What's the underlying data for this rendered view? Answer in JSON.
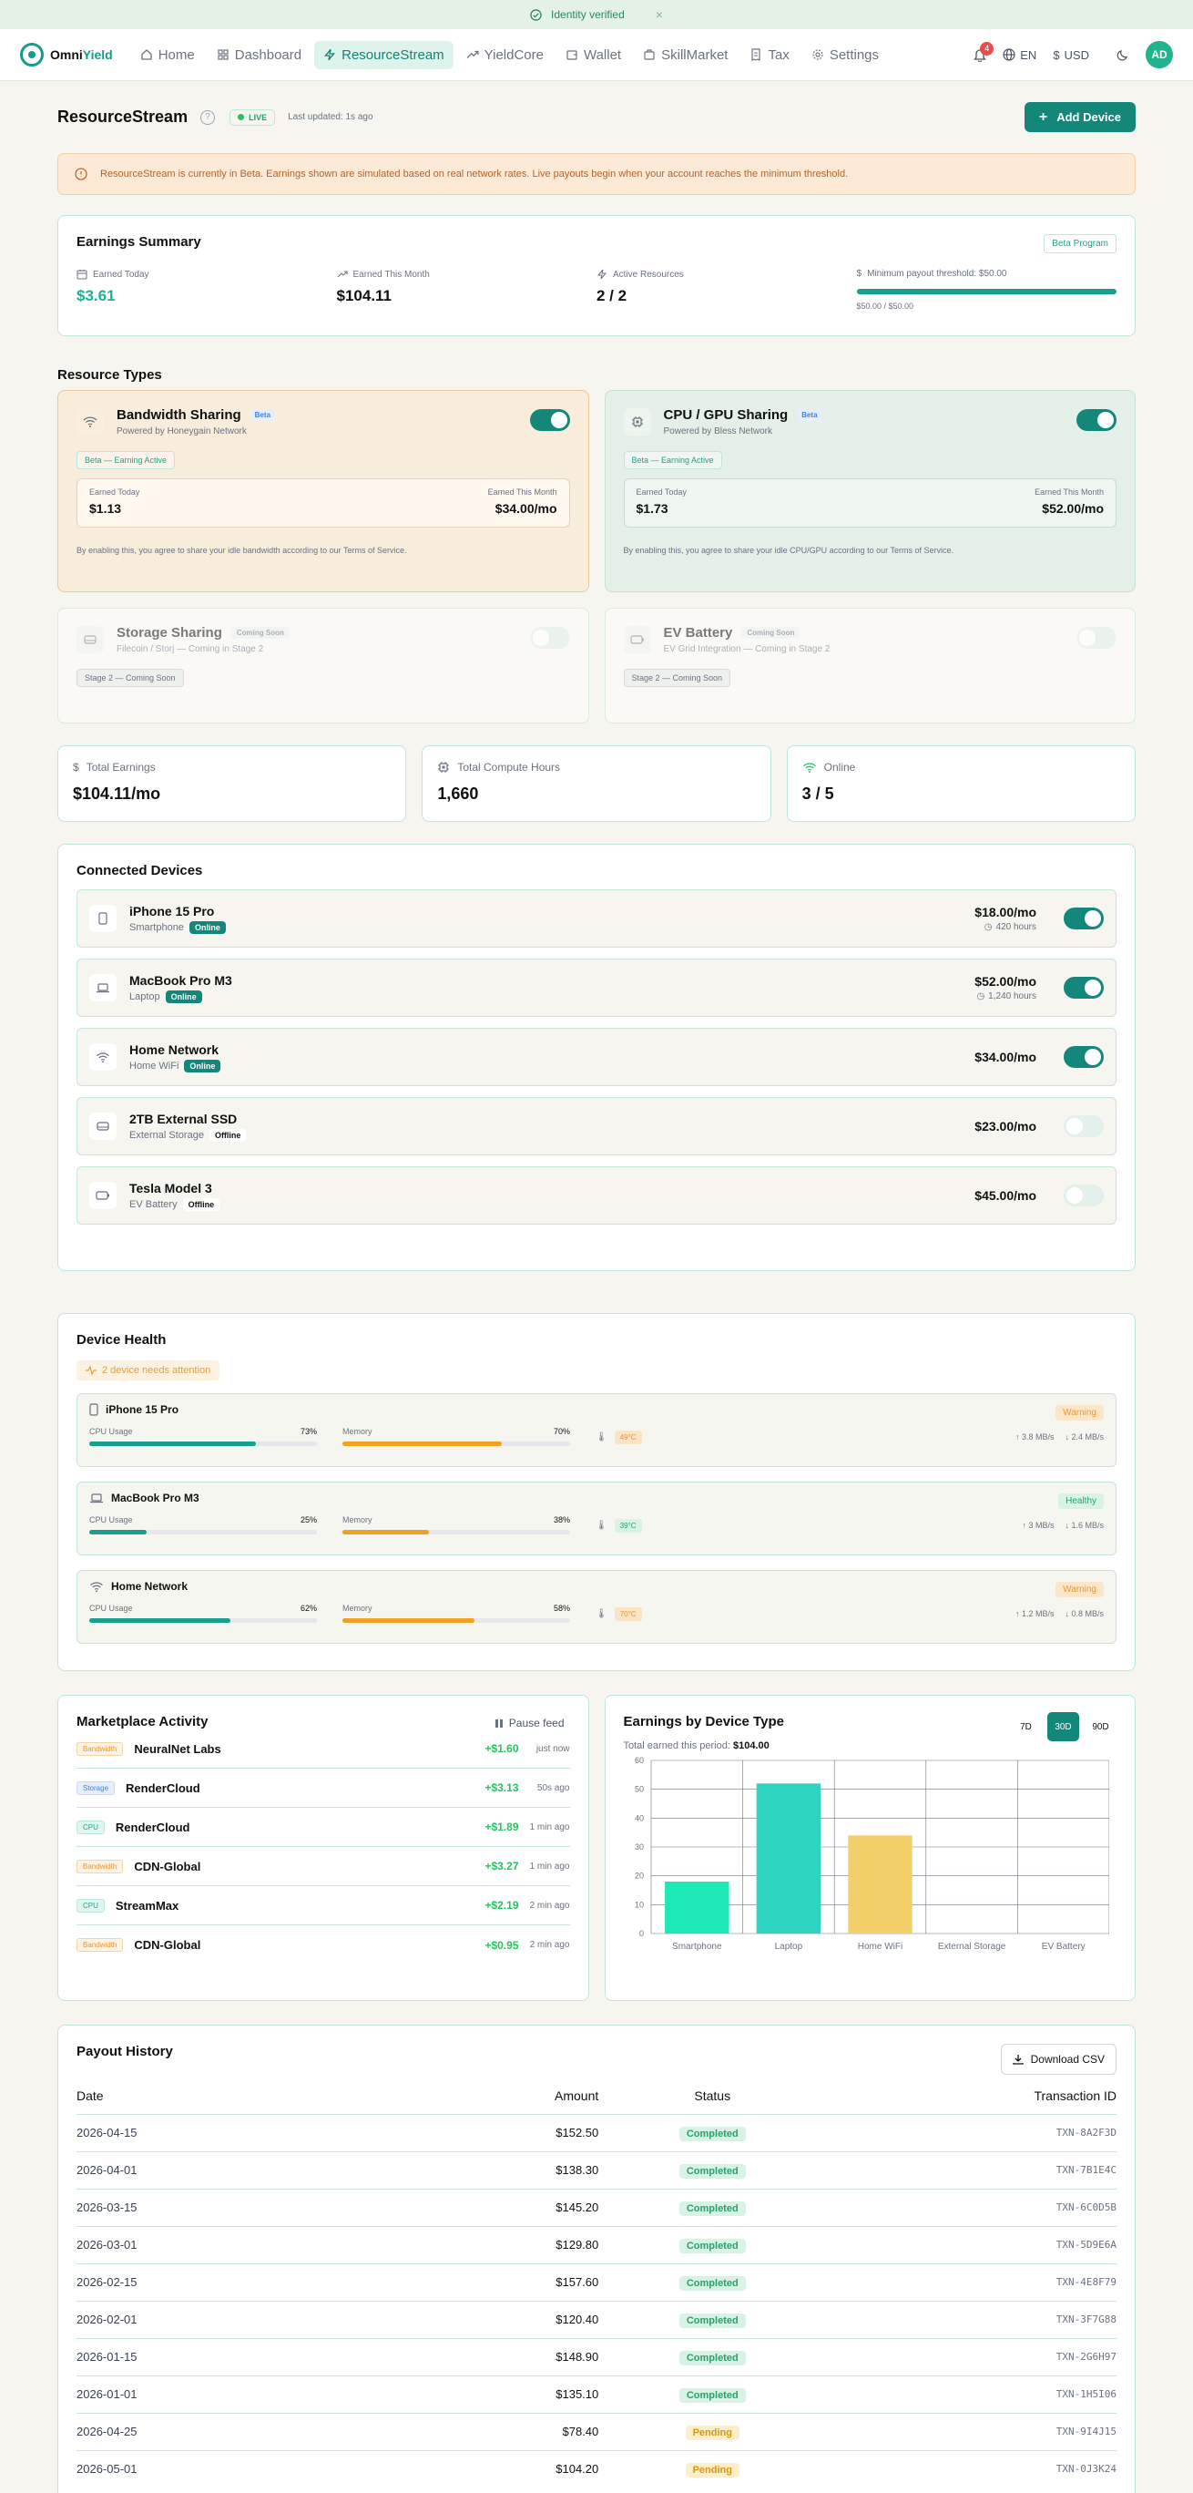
{
  "banner": {
    "text": "Identity verified",
    "close": "×"
  },
  "nav": {
    "brand_a": "Omni",
    "brand_b": "Yield",
    "items": [
      {
        "label": "Home",
        "icon": "home-icon"
      },
      {
        "label": "Dashboard",
        "icon": "grid-icon"
      },
      {
        "label": "ResourceStream",
        "icon": "bolt-icon",
        "active": true
      },
      {
        "label": "YieldCore",
        "icon": "trend-icon"
      },
      {
        "label": "Wallet",
        "icon": "wallet-icon"
      },
      {
        "label": "SkillMarket",
        "icon": "briefcase-icon"
      },
      {
        "label": "Tax",
        "icon": "receipt-icon"
      },
      {
        "label": "Settings",
        "icon": "gear-icon"
      }
    ],
    "notif_count": "4",
    "lang": "EN",
    "currency": "USD",
    "avatar": "AD"
  },
  "page": {
    "title": "ResourceStream",
    "live": "LIVE",
    "updated": "Last updated: 1s ago",
    "add_device": "Add Device"
  },
  "alert": "ResourceStream is currently in Beta. Earnings shown are simulated based on real network rates. Live payouts begin when your account reaches the minimum threshold.",
  "earnings": {
    "title": "Earnings Summary",
    "badge": "Beta Program",
    "today_label": "Earned Today",
    "today": "$3.61",
    "month_label": "Earned This Month",
    "month": "$104.11",
    "active_label": "Active Resources",
    "active": "2 / 2",
    "threshold_label": "Minimum payout threshold: $50.00",
    "threshold_progress": 1.0,
    "threshold_value": "$50.00 / $50.00"
  },
  "resources": {
    "title": "Resource Types",
    "bandwidth": {
      "name": "Bandwidth Sharing",
      "tag": "Beta",
      "sub": "Powered by Honeygain Network",
      "status": "Beta — Earning Active",
      "today_label": "Earned Today",
      "today": "$1.13",
      "month_label": "Earned This Month",
      "month": "$34.00/mo",
      "terms": "By enabling this, you agree to share your idle bandwidth according to our Terms of Service."
    },
    "cpu": {
      "name": "CPU / GPU Sharing",
      "tag": "Beta",
      "sub": "Powered by Bless Network",
      "status": "Beta — Earning Active",
      "today_label": "Earned Today",
      "today": "$1.73",
      "month_label": "Earned This Month",
      "month": "$52.00/mo",
      "terms": "By enabling this, you agree to share your idle CPU/GPU according to our Terms of Service."
    },
    "storage": {
      "name": "Storage Sharing",
      "tag": "Coming Soon",
      "sub": "Filecoin / Storj — Coming in Stage 2",
      "status": "Stage 2 — Coming Soon"
    },
    "ev": {
      "name": "EV Battery",
      "tag": "Coming Soon",
      "sub": "EV Grid Integration — Coming in Stage 2",
      "status": "Stage 2 — Coming Soon"
    }
  },
  "totals": {
    "earnings_label": "Total Earnings",
    "earnings": "$104.11/mo",
    "compute_label": "Total Compute Hours",
    "compute": "1,660",
    "online_label": "Online",
    "online": "3 / 5"
  },
  "devices": {
    "title": "Connected Devices",
    "items": [
      {
        "name": "iPhone 15 Pro",
        "type": "Smartphone",
        "status": "Online",
        "price": "$18.00/mo",
        "hours": "420 hours",
        "on": true,
        "icon": "phone-icon"
      },
      {
        "name": "MacBook Pro M3",
        "type": "Laptop",
        "status": "Online",
        "price": "$52.00/mo",
        "hours": "1,240 hours",
        "on": true,
        "icon": "laptop-icon"
      },
      {
        "name": "Home Network",
        "type": "Home WiFi",
        "status": "Online",
        "price": "$34.00/mo",
        "hours": "",
        "on": true,
        "icon": "wifi-icon"
      },
      {
        "name": "2TB External SSD",
        "type": "External Storage",
        "status": "Offline",
        "price": "$23.00/mo",
        "hours": "",
        "on": false,
        "icon": "drive-icon"
      },
      {
        "name": "Tesla Model 3",
        "type": "EV Battery",
        "status": "Offline",
        "price": "$45.00/mo",
        "hours": "",
        "on": false,
        "icon": "battery-icon"
      }
    ]
  },
  "health": {
    "title": "Device Health",
    "attention": "2 device needs attention",
    "cpu_label": "CPU Usage",
    "mem_label": "Memory",
    "items": [
      {
        "name": "iPhone 15 Pro",
        "status": "Warning",
        "cpu": "73%",
        "cpu_v": 0.73,
        "mem": "70%",
        "mem_v": 0.7,
        "temp": "49°C",
        "up": "3.8 MB/s",
        "down": "2.4 MB/s",
        "icon": "phone-icon"
      },
      {
        "name": "MacBook Pro M3",
        "status": "Healthy",
        "cpu": "25%",
        "cpu_v": 0.25,
        "mem": "38%",
        "mem_v": 0.38,
        "temp": "39°C",
        "up": "3 MB/s",
        "down": "1.6 MB/s",
        "icon": "laptop-icon"
      },
      {
        "name": "Home Network",
        "status": "Warning",
        "cpu": "62%",
        "cpu_v": 0.62,
        "mem": "58%",
        "mem_v": 0.58,
        "temp": "70°C",
        "up": "1.2 MB/s",
        "down": "0.8 MB/s",
        "icon": "wifi-icon"
      }
    ]
  },
  "market": {
    "title": "Marketplace Activity",
    "pause": "Pause feed",
    "items": [
      {
        "cat": "Bandwidth",
        "name": "NeuralNet Labs",
        "amount": "+$1.60",
        "time": "just now"
      },
      {
        "cat": "Storage",
        "name": "RenderCloud",
        "amount": "+$3.13",
        "time": "50s ago"
      },
      {
        "cat": "CPU",
        "name": "RenderCloud",
        "amount": "+$1.89",
        "time": "1 min ago"
      },
      {
        "cat": "Bandwidth",
        "name": "CDN-Global",
        "amount": "+$3.27",
        "time": "1 min ago"
      },
      {
        "cat": "CPU",
        "name": "StreamMax",
        "amount": "+$2.19",
        "time": "2 min ago"
      },
      {
        "cat": "Bandwidth",
        "name": "CDN-Global",
        "amount": "+$0.95",
        "time": "2 min ago"
      }
    ]
  },
  "earnings_chart": {
    "title": "Earnings by Device Type",
    "ranges": [
      "7D",
      "30D",
      "90D"
    ],
    "selected": "30D",
    "total_label": "Total earned this period:",
    "total": "$104.00"
  },
  "chart_data": {
    "type": "bar",
    "title": "Earnings by Device Type",
    "categories": [
      "Smartphone",
      "Laptop",
      "Home WiFi",
      "External Storage",
      "EV Battery"
    ],
    "values": [
      18,
      52,
      34,
      0,
      0
    ],
    "colors": [
      "#1de9b6",
      "#2dd4bf",
      "#f4d06b",
      "#cccccc",
      "#cccccc"
    ],
    "ylim": [
      0,
      60
    ],
    "yticks": [
      0,
      10,
      20,
      30,
      40,
      50,
      60
    ],
    "grid": true
  },
  "payout": {
    "title": "Payout History",
    "download": "Download CSV",
    "headers": {
      "date": "Date",
      "amount": "Amount",
      "status": "Status",
      "tx": "Transaction ID"
    },
    "rows": [
      {
        "date": "2026-04-15",
        "amount": "$152.50",
        "status": "Completed",
        "tx": "TXN-8A2F3D"
      },
      {
        "date": "2026-04-01",
        "amount": "$138.30",
        "status": "Completed",
        "tx": "TXN-7B1E4C"
      },
      {
        "date": "2026-03-15",
        "amount": "$145.20",
        "status": "Completed",
        "tx": "TXN-6C0D5B"
      },
      {
        "date": "2026-03-01",
        "amount": "$129.80",
        "status": "Completed",
        "tx": "TXN-5D9E6A"
      },
      {
        "date": "2026-02-15",
        "amount": "$157.60",
        "status": "Completed",
        "tx": "TXN-4E8F79"
      },
      {
        "date": "2026-02-01",
        "amount": "$120.40",
        "status": "Completed",
        "tx": "TXN-3F7G88"
      },
      {
        "date": "2026-01-15",
        "amount": "$148.90",
        "status": "Completed",
        "tx": "TXN-2G6H97"
      },
      {
        "date": "2026-01-01",
        "amount": "$135.10",
        "status": "Completed",
        "tx": "TXN-1H5I06"
      },
      {
        "date": "2026-04-25",
        "amount": "$78.40",
        "status": "Pending",
        "tx": "TXN-9I4J15"
      },
      {
        "date": "2026-05-01",
        "amount": "$104.20",
        "status": "Pending",
        "tx": "TXN-0J3K24"
      }
    ]
  }
}
